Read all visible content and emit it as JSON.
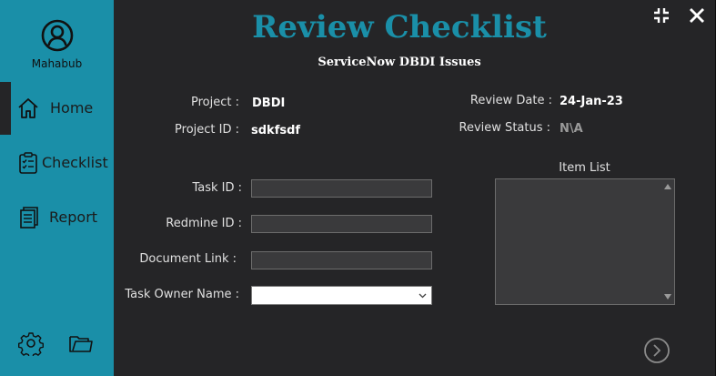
{
  "colors": {
    "accent": "#1a8fa8",
    "background": "#252527",
    "text": "#e0e0e0"
  },
  "sidebar": {
    "user_name": "Mahabub",
    "user_icon": "user-circle-icon",
    "items": [
      {
        "label": "Home",
        "icon": "home-icon",
        "active": true
      },
      {
        "label": "Checklist",
        "icon": "clipboard-icon",
        "active": false
      },
      {
        "label": "Report",
        "icon": "document-icon",
        "active": false
      }
    ],
    "bottom_icons": [
      "gear-icon",
      "folder-icon"
    ]
  },
  "header": {
    "title": "Review Checklist",
    "subtitle": "ServiceNow DBDI Issues"
  },
  "window_controls": [
    "minimize-icon",
    "close-icon"
  ],
  "info": {
    "project_label": "Project :",
    "project_value": "DBDI",
    "project_id_label": "Project ID :",
    "project_id_value": "sdkfsdf",
    "review_date_label": "Review Date :",
    "review_date_value": "24-Jan-23",
    "review_status_label": "Review Status :",
    "review_status_value": "N\\A"
  },
  "form": {
    "task_id_label": "Task ID :",
    "task_id_value": "",
    "redmine_id_label": "Redmine ID :",
    "redmine_id_value": "",
    "document_link_label": "Document Link :",
    "document_link_value": "",
    "task_owner_label": "Task Owner Name :",
    "task_owner_value": ""
  },
  "item_list": {
    "title": "Item List",
    "items": []
  },
  "next_button_icon": "chevron-right-circle-icon"
}
